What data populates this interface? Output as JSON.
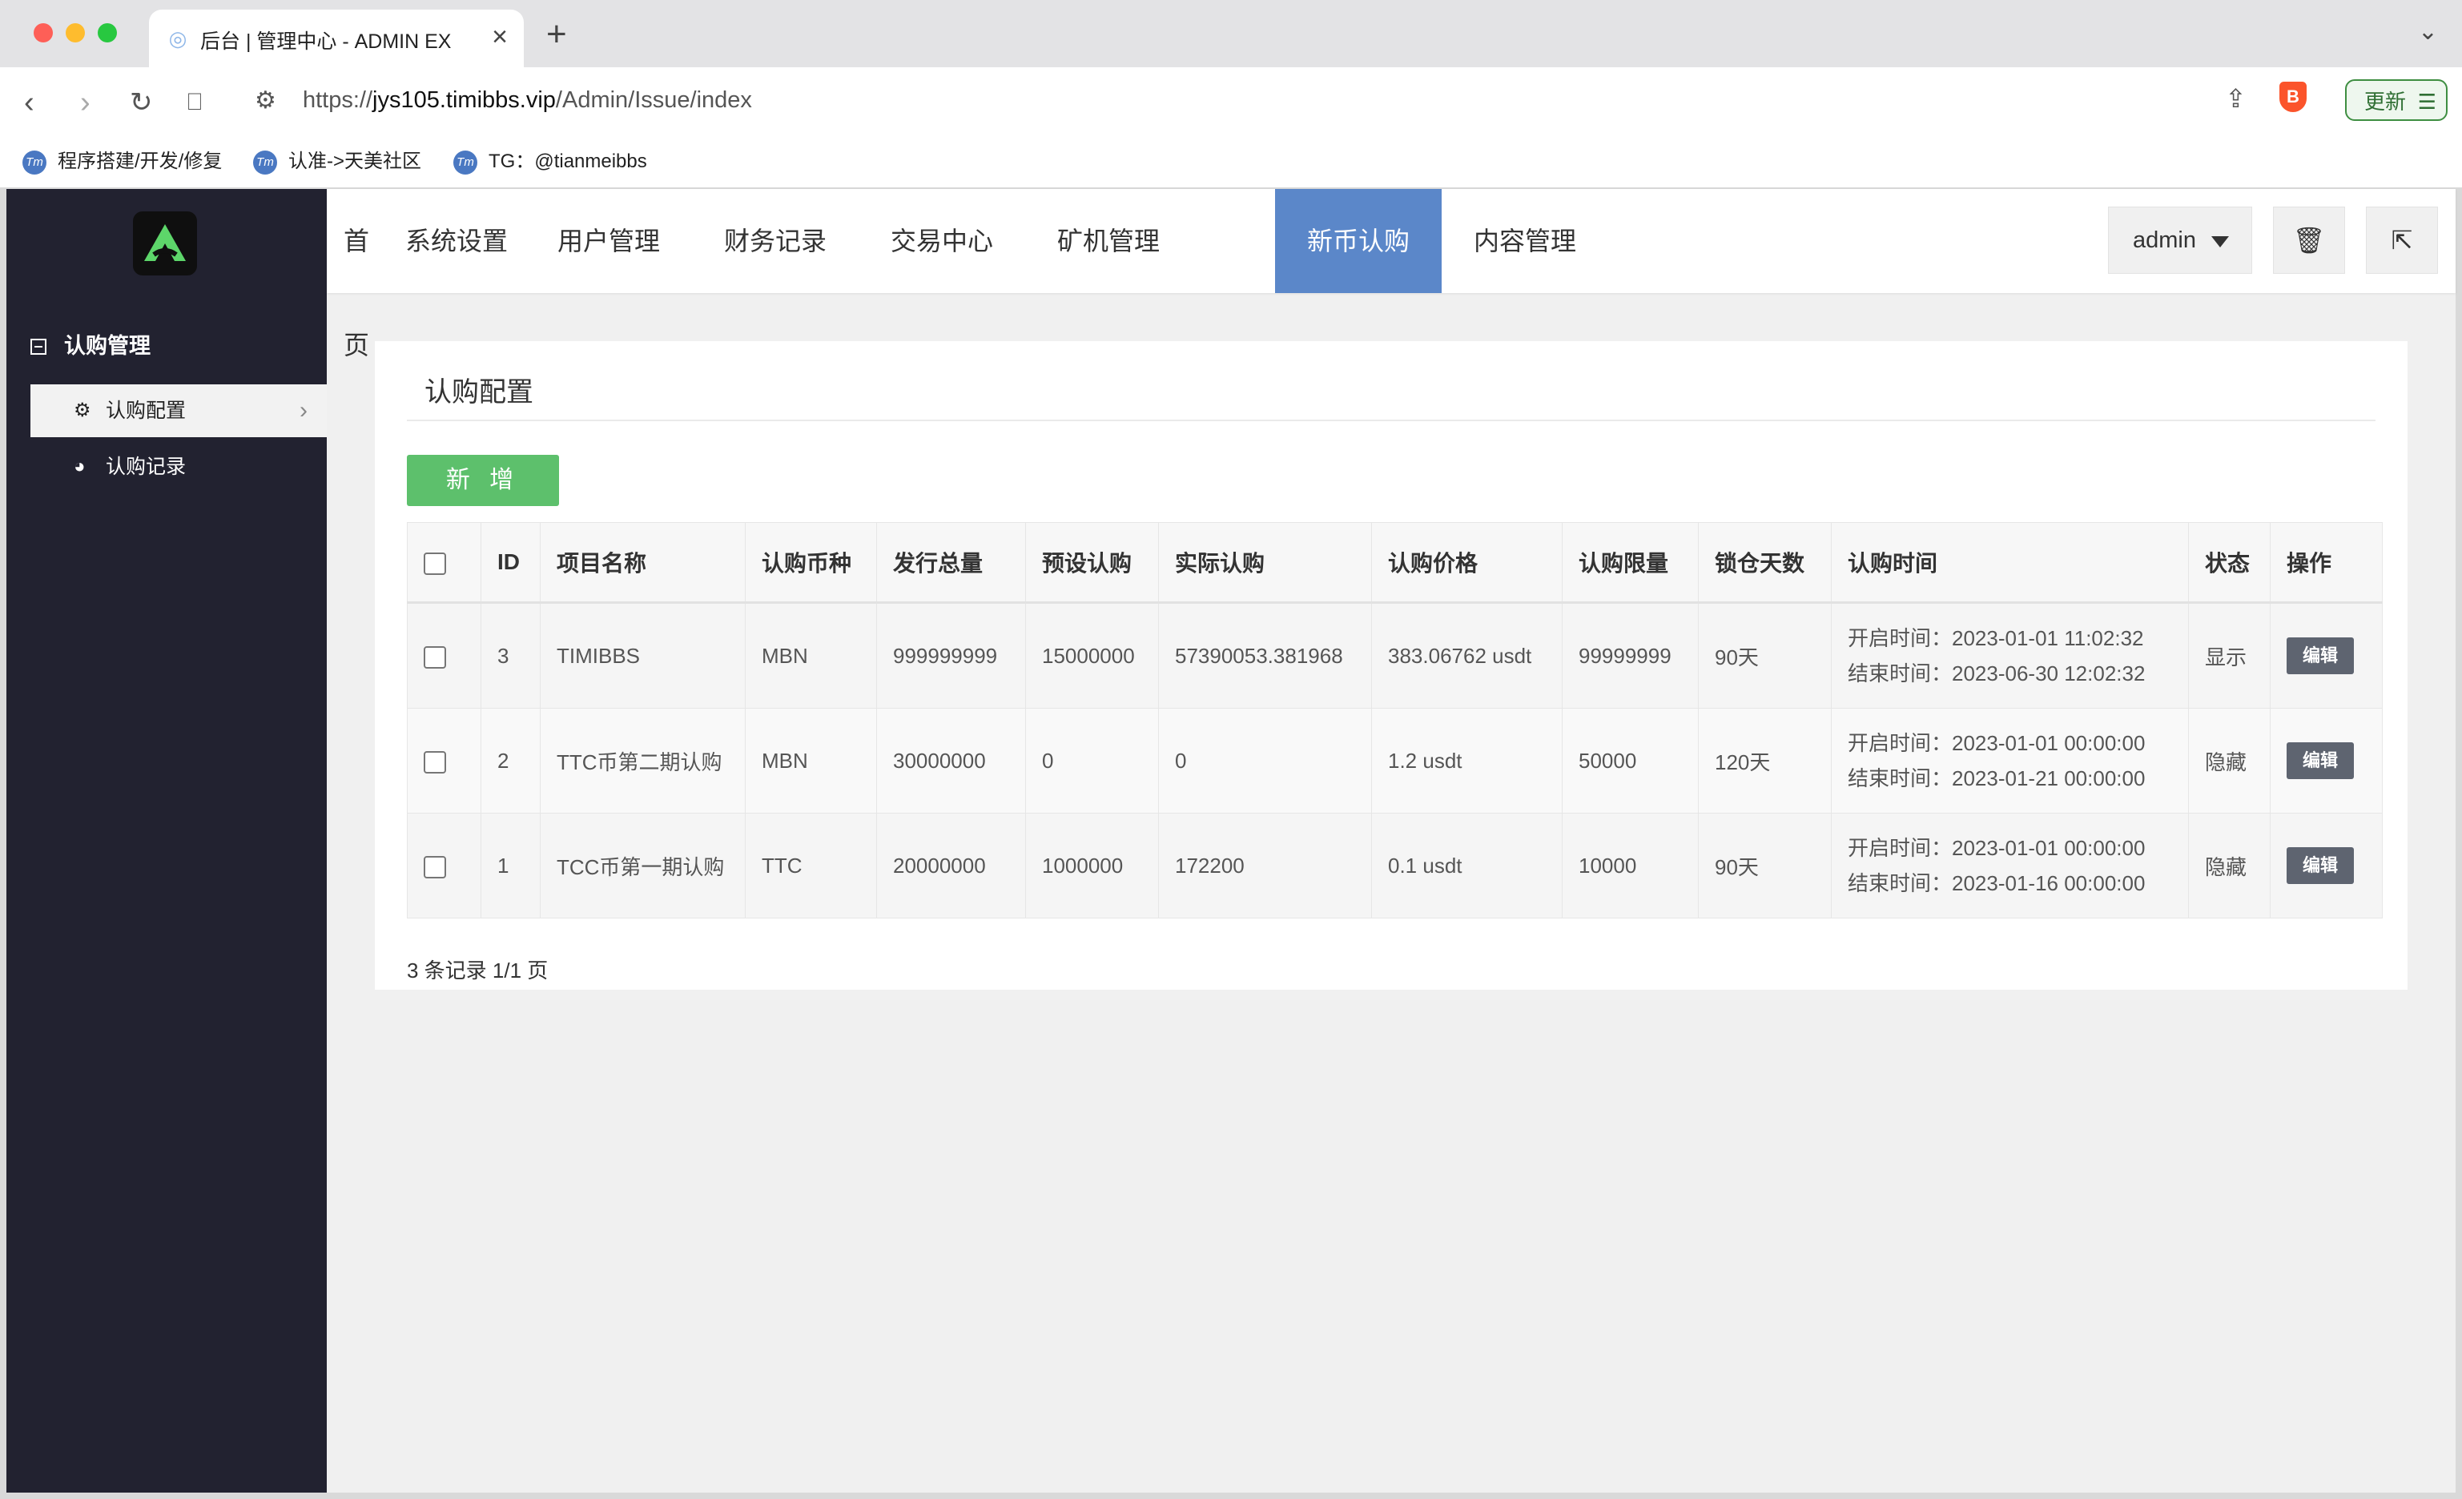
{
  "browser": {
    "tab_title": "后台 | 管理中心 - ADMIN EX",
    "url_prefix": "https://",
    "url_host": "jys105.timibbs.vip",
    "url_path": "/Admin/Issue/index",
    "update_label": "更新",
    "bookmarks": [
      {
        "label": "程序搭建/开发/修复"
      },
      {
        "label": "认准->天美社区"
      },
      {
        "label": "TG：@tianmeibbs"
      }
    ]
  },
  "sidebar": {
    "group_label": "认购管理",
    "items": [
      {
        "label": "认购配置",
        "active": true
      },
      {
        "label": "认购记录",
        "active": false
      }
    ]
  },
  "topnav": {
    "items": [
      {
        "label": "首页"
      },
      {
        "label": "系统设置"
      },
      {
        "label": "用户管理"
      },
      {
        "label": "财务记录"
      },
      {
        "label": "交易中心"
      },
      {
        "label": "矿机管理"
      },
      {
        "label": "新币认购",
        "active": true
      },
      {
        "label": "内容管理"
      }
    ],
    "user_label": "admin"
  },
  "panel": {
    "title": "认购配置",
    "add_button": "新 增",
    "columns": [
      "ID",
      "项目名称",
      "认购币种",
      "发行总量",
      "预设认购",
      "实际认购",
      "认购价格",
      "认购限量",
      "锁仓天数",
      "认购时间",
      "状态",
      "操作"
    ],
    "rows": [
      {
        "id": "3",
        "name": "TIMIBBS",
        "coin": "MBN",
        "total": "999999999",
        "preset": "15000000",
        "actual": "57390053.381968",
        "price": "383.06762 usdt",
        "limit": "99999999",
        "lock_days": "90天",
        "start": "开启时间：2023-01-01 11:02:32",
        "end": "结束时间：2023-06-30 12:02:32",
        "status": "显示",
        "action": "编辑"
      },
      {
        "id": "2",
        "name": "TTC币第二期认购",
        "coin": "MBN",
        "total": "30000000",
        "preset": "0",
        "actual": "0",
        "price": "1.2 usdt",
        "limit": "50000",
        "lock_days": "120天",
        "start": "开启时间：2023-01-01 00:00:00",
        "end": "结束时间：2023-01-21 00:00:00",
        "status": "隐藏",
        "action": "编辑"
      },
      {
        "id": "1",
        "name": "TCC币第一期认购",
        "coin": "TTC",
        "total": "20000000",
        "preset": "1000000",
        "actual": "172200",
        "price": "0.1 usdt",
        "limit": "10000",
        "lock_days": "90天",
        "start": "开启时间：2023-01-01 00:00:00",
        "end": "结束时间：2023-01-16 00:00:00",
        "status": "隐藏",
        "action": "编辑"
      }
    ],
    "pager_text": "3 条记录 1/1 页"
  },
  "colors": {
    "sidebar_bg": "#222230",
    "nav_active": "#5b87c9",
    "add_button": "#5dc06c",
    "edit_button": "#5e6470"
  }
}
